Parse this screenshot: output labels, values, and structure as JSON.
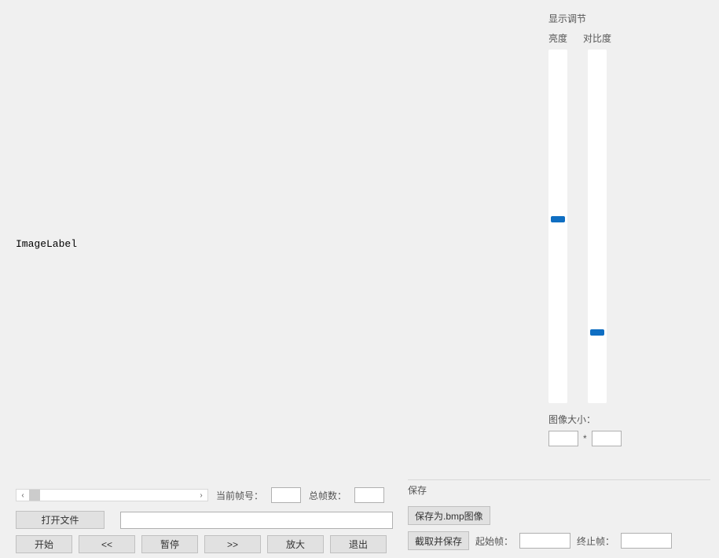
{
  "image_area": {
    "label": "ImageLabel"
  },
  "display_panel": {
    "title": "显示调节",
    "brightness": {
      "label": "亮度",
      "value_percent": 53
    },
    "contrast": {
      "label": "对比度",
      "value_percent": 21
    },
    "image_size": {
      "label": "图像大小：",
      "width": "",
      "height": "",
      "separator": "*"
    }
  },
  "playback": {
    "scrollbar": {
      "left_arrow": "‹",
      "right_arrow": "›"
    },
    "current_frame": {
      "label": "当前帧号：",
      "value": ""
    },
    "total_frames": {
      "label": "总帧数：",
      "value": ""
    },
    "open_file_btn": "打开文件",
    "file_path": "",
    "controls": {
      "start": "开始",
      "prev": "<<",
      "pause": "暂停",
      "next": ">>",
      "zoom": "放大",
      "exit": "退出"
    }
  },
  "save_panel": {
    "title": "保存",
    "save_bmp_btn": "保存为.bmp图像",
    "clip_save_btn": "截取并保存",
    "start_frame": {
      "label": "起始帧：",
      "value": ""
    },
    "end_frame": {
      "label": "终止帧：",
      "value": ""
    }
  }
}
